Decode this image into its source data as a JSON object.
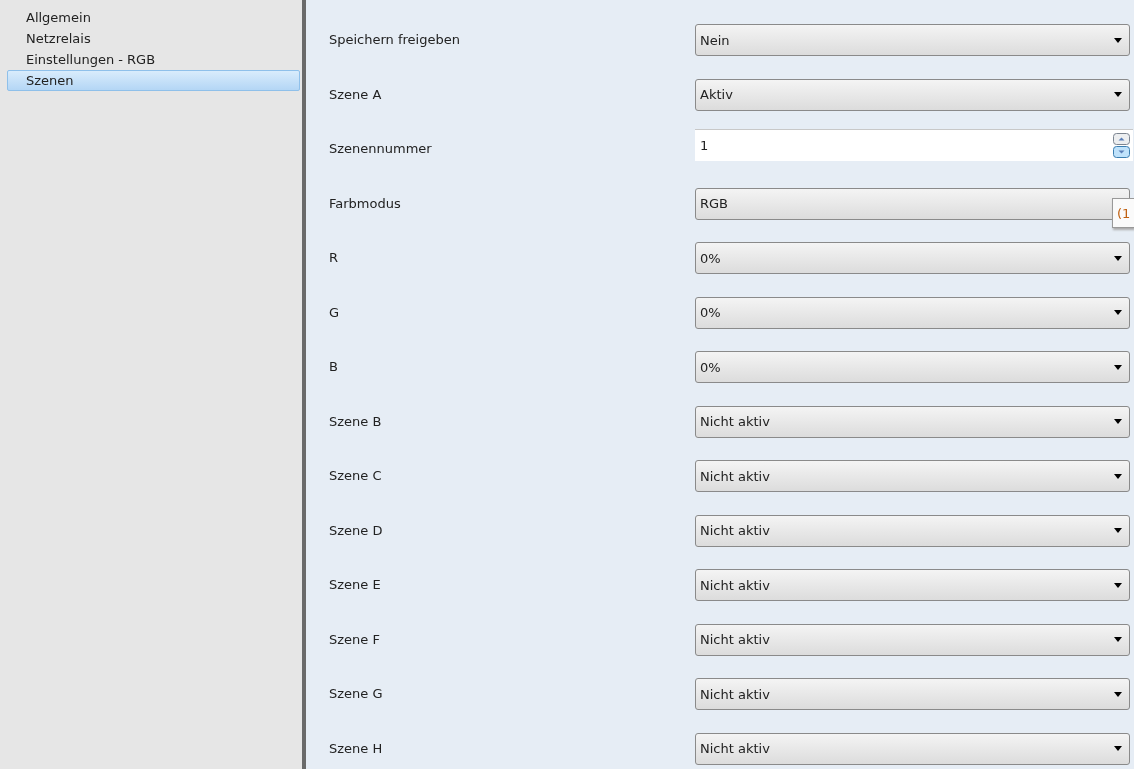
{
  "sidebar": {
    "items": [
      {
        "label": "Allgemein",
        "selected": false
      },
      {
        "label": "Netzrelais",
        "selected": false
      },
      {
        "label": "Einstellungen - RGB",
        "selected": false
      },
      {
        "label": "Szenen",
        "selected": true
      }
    ]
  },
  "parameters": [
    {
      "label": "Speichern freigeben",
      "kind": "dropdown",
      "value": "Nein"
    },
    {
      "label": "Szene A",
      "kind": "dropdown",
      "value": "Aktiv"
    },
    {
      "label": "Szenennummer",
      "kind": "spinner",
      "value": "1"
    },
    {
      "label": "Farbmodus",
      "kind": "dropdown",
      "value": "RGB",
      "tooltip": "(1"
    },
    {
      "label": "R",
      "kind": "dropdown",
      "value": "0%"
    },
    {
      "label": "G",
      "kind": "dropdown",
      "value": "0%"
    },
    {
      "label": "B",
      "kind": "dropdown",
      "value": "0%"
    },
    {
      "label": "Szene B",
      "kind": "dropdown",
      "value": "Nicht aktiv"
    },
    {
      "label": "Szene C",
      "kind": "dropdown",
      "value": "Nicht aktiv"
    },
    {
      "label": "Szene D",
      "kind": "dropdown",
      "value": "Nicht aktiv"
    },
    {
      "label": "Szene E",
      "kind": "dropdown",
      "value": "Nicht aktiv"
    },
    {
      "label": "Szene F",
      "kind": "dropdown",
      "value": "Nicht aktiv"
    },
    {
      "label": "Szene G",
      "kind": "dropdown",
      "value": "Nicht aktiv"
    },
    {
      "label": "Szene H",
      "kind": "dropdown",
      "value": "Nicht aktiv"
    }
  ]
}
